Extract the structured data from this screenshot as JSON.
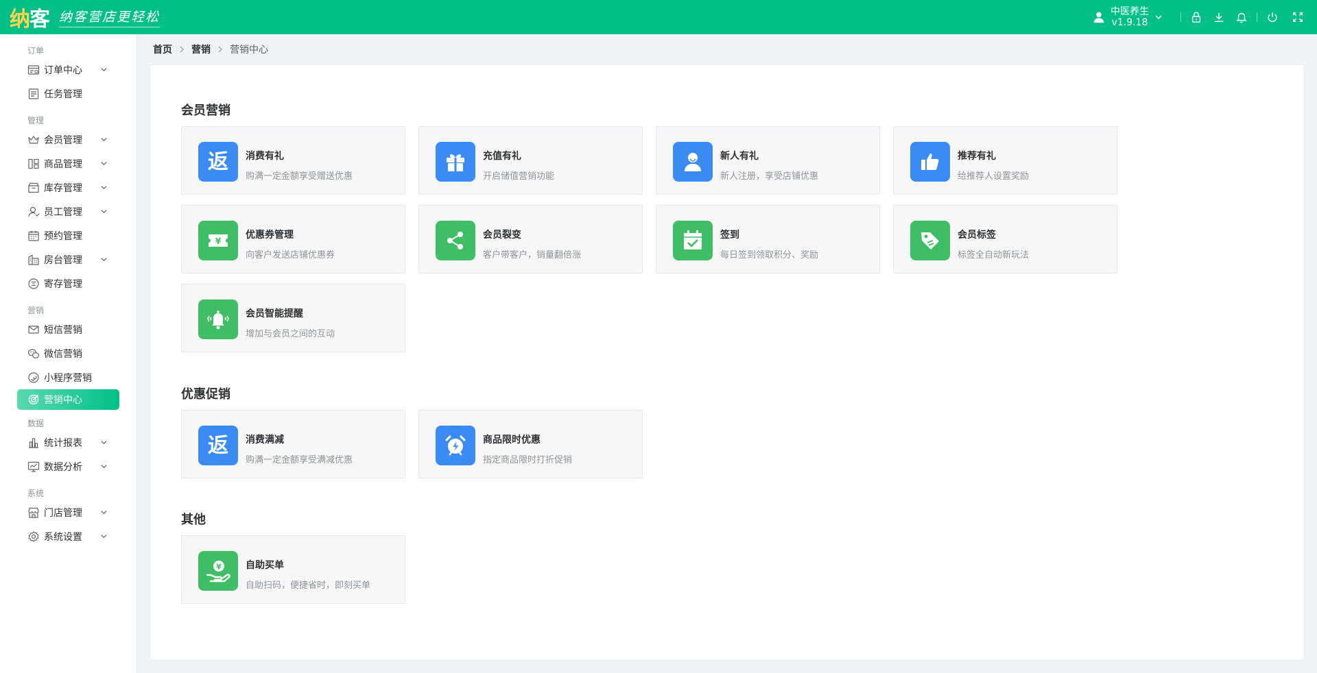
{
  "header": {
    "logo_prefix": "纳",
    "logo_suffix": "客",
    "slogan": "纳客营店更轻松",
    "user_name": "中医养生",
    "version": "v1.9.18",
    "bg_color": "#00c087"
  },
  "sidebar": {
    "groups": [
      {
        "title": "订单",
        "items": [
          {
            "label": "订单中心",
            "icon": "order-center-icon",
            "caret": true
          },
          {
            "label": "任务管理",
            "icon": "task-icon",
            "caret": false
          }
        ]
      },
      {
        "title": "管理",
        "items": [
          {
            "label": "会员管理",
            "icon": "crown-icon",
            "caret": true
          },
          {
            "label": "商品管理",
            "icon": "product-icon",
            "caret": true
          },
          {
            "label": "库存管理",
            "icon": "inventory-icon",
            "caret": true
          },
          {
            "label": "员工管理",
            "icon": "staff-icon",
            "caret": true
          },
          {
            "label": "预约管理",
            "icon": "calendar-icon",
            "caret": false
          },
          {
            "label": "房台管理",
            "icon": "room-icon",
            "caret": true
          },
          {
            "label": "寄存管理",
            "icon": "storage-icon",
            "caret": false
          }
        ]
      },
      {
        "title": "营销",
        "items": [
          {
            "label": "短信营销",
            "icon": "mail-icon",
            "caret": false
          },
          {
            "label": "微信营销",
            "icon": "wechat-icon",
            "caret": false
          },
          {
            "label": "小程序营销",
            "icon": "mini-program-icon",
            "caret": false
          },
          {
            "label": "营销中心",
            "icon": "target-icon",
            "caret": false,
            "active": true
          }
        ]
      },
      {
        "title": "数据",
        "items": [
          {
            "label": "统计报表",
            "icon": "bar-chart-icon",
            "caret": true
          },
          {
            "label": "数据分析",
            "icon": "monitor-chart-icon",
            "caret": true
          }
        ]
      },
      {
        "title": "系统",
        "items": [
          {
            "label": "门店管理",
            "icon": "store-icon",
            "caret": true
          },
          {
            "label": "系统设置",
            "icon": "gear-icon",
            "caret": true
          }
        ]
      }
    ]
  },
  "breadcrumb": [
    "首页",
    "营销",
    "营销中心"
  ],
  "sections": {
    "member": {
      "title": "会员营销",
      "cards": [
        {
          "title": "消费有礼",
          "desc": "购满一定金额享受赠送优惠",
          "icon": "rebate-icon",
          "color": "blue"
        },
        {
          "title": "充值有礼",
          "desc": "开启储值营销功能",
          "icon": "gift-icon",
          "color": "blue"
        },
        {
          "title": "新人有礼",
          "desc": "新人注册，享受店铺优惠",
          "icon": "new-user-icon",
          "color": "blue"
        },
        {
          "title": "推荐有礼",
          "desc": "给推荐人设置奖励",
          "icon": "thumbs-up-icon",
          "color": "blue"
        },
        {
          "title": "优惠券管理",
          "desc": "向客户发送店铺优惠券",
          "icon": "coupon-icon",
          "color": "green"
        },
        {
          "title": "会员裂变",
          "desc": "客户带客户，销量翻倍涨",
          "icon": "share-icon",
          "color": "green"
        },
        {
          "title": "签到",
          "desc": "每日签到领取积分、奖励",
          "icon": "checkin-icon",
          "color": "green"
        },
        {
          "title": "会员标签",
          "desc": "标签全自动新玩法",
          "icon": "tag-icon",
          "color": "green"
        },
        {
          "title": "会员智能提醒",
          "desc": "增加与会员之间的互动",
          "icon": "bell-reminder-icon",
          "color": "green"
        }
      ]
    },
    "promo": {
      "title": "优惠促销",
      "cards": [
        {
          "title": "消费满减",
          "desc": "购满一定金额享受满减优惠",
          "icon": "rebate-icon",
          "color": "blue"
        },
        {
          "title": "商品限时优惠",
          "desc": "指定商品限时打折促销",
          "icon": "alarm-clock-icon",
          "color": "blue"
        }
      ]
    },
    "other": {
      "title": "其他",
      "cards": [
        {
          "title": "自助买单",
          "desc": "自助扫码，便捷省时，即刻买单",
          "icon": "self-pay-icon",
          "color": "green"
        }
      ]
    }
  }
}
